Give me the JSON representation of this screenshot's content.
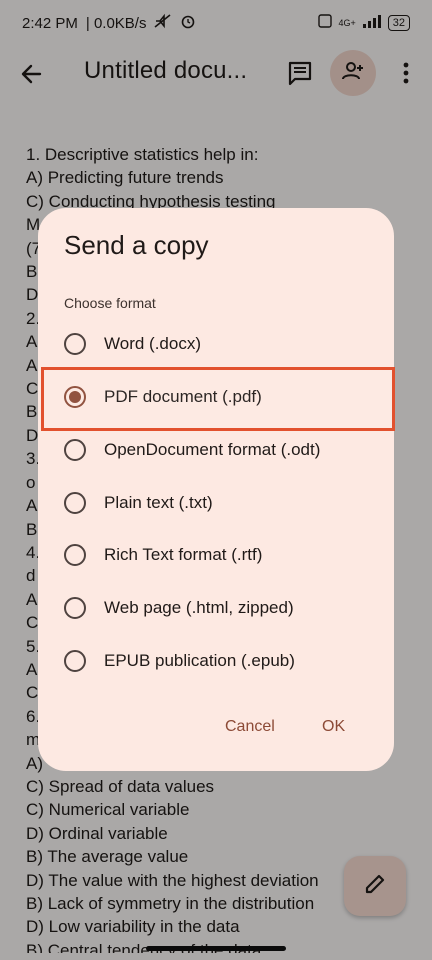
{
  "status_bar": {
    "time": "2:42 PM",
    "net": "| 0.0KB/s",
    "battery": "32",
    "signal_text": "4G+"
  },
  "app_bar": {
    "title": "Untitled docu..."
  },
  "document": {
    "lines": [
      "1. Descriptive statistics help in:",
      "A) Predicting future trends",
      "C) Conducting hypothesis testing",
      "M",
      "(7",
      "B",
      "D",
      "2.",
      "A",
      "A",
      "C",
      "B",
      "D",
      "3.",
      "o",
      "A",
      "B",
      "4.",
      "d",
      "A",
      "C",
      "5.",
      "A",
      "C",
      "6.",
      "m",
      "A)",
      "C) Spread of data values",
      "C) Numerical variable",
      "D) Ordinal variable",
      "B) The average value",
      "D) The value with the highest deviation",
      "B) Lack of symmetry in the distribution",
      "D) Low variability in the data",
      "B) Central tendency of the data"
    ]
  },
  "dialog": {
    "title": "Send a copy",
    "subtitle": "Choose format",
    "options": [
      {
        "label": "Word (.docx)",
        "selected": false
      },
      {
        "label": "PDF document (.pdf)",
        "selected": true
      },
      {
        "label": "OpenDocument format (.odt)",
        "selected": false
      },
      {
        "label": "Plain text (.txt)",
        "selected": false
      },
      {
        "label": "Rich Text format (.rtf)",
        "selected": false
      },
      {
        "label": "Web page (.html, zipped)",
        "selected": false
      },
      {
        "label": "EPUB publication (.epub)",
        "selected": false
      }
    ],
    "cancel_label": "Cancel",
    "ok_label": "OK"
  },
  "colors": {
    "accent": "#8c4a36",
    "dialog_bg": "#fde9e2",
    "highlight_border": "#e2512e",
    "fab_bg": "#f7dbd0"
  },
  "icons": {
    "back": "arrow-back-icon",
    "comment": "comment-icon",
    "share": "person-add-icon",
    "more": "more-vert-icon",
    "edit": "pencil-icon"
  }
}
